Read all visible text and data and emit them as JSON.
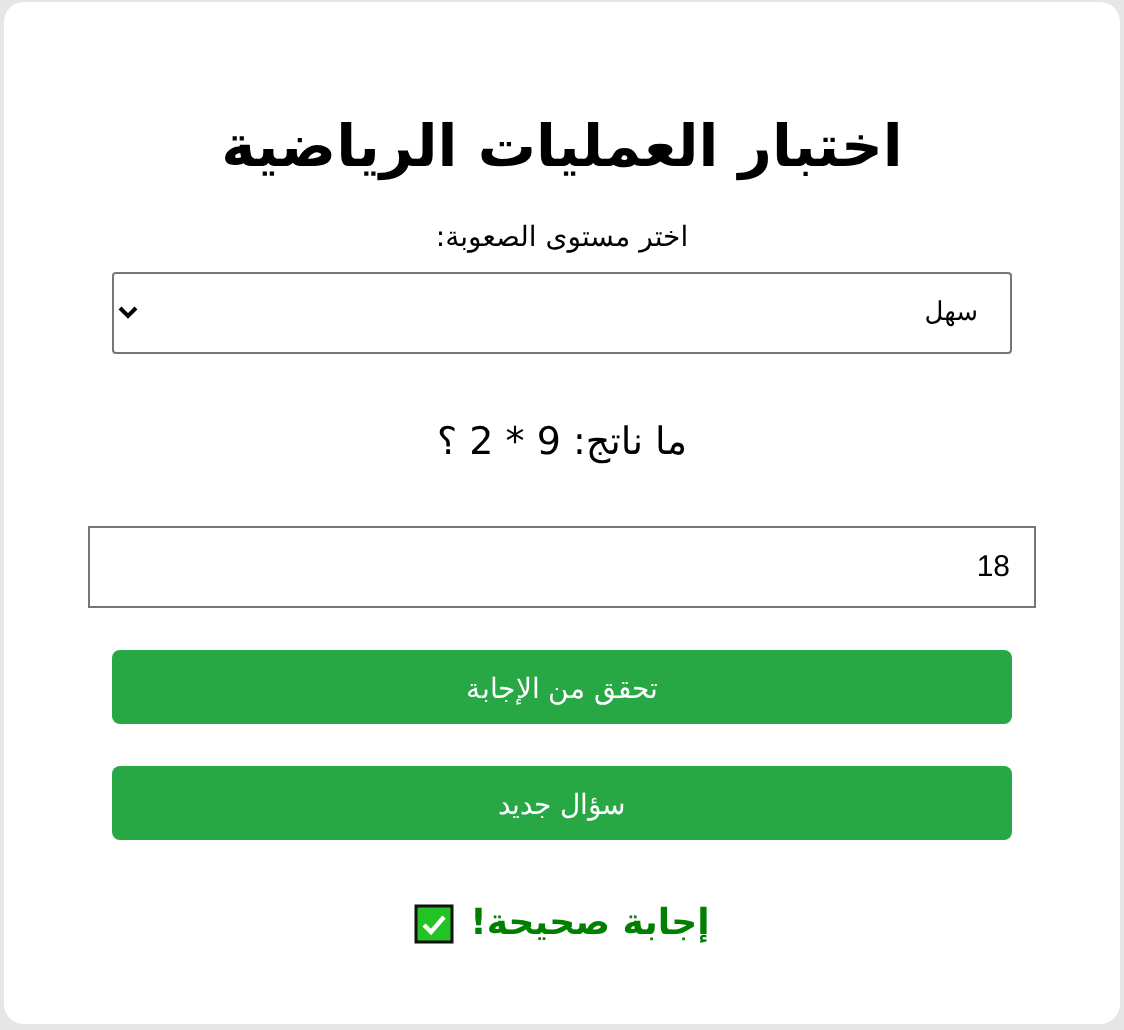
{
  "title": "اختبار العمليات الرياضية",
  "difficulty": {
    "label": "اختر مستوى الصعوبة:",
    "value": "سهل"
  },
  "question": "ما ناتج: 9 * 2 ؟",
  "answer": {
    "value": "18"
  },
  "buttons": [
    "تحقق من الإجابة",
    "سؤال جديد"
  ],
  "result": {
    "text": "إجابة صحيحة!",
    "kind": "correct"
  }
}
